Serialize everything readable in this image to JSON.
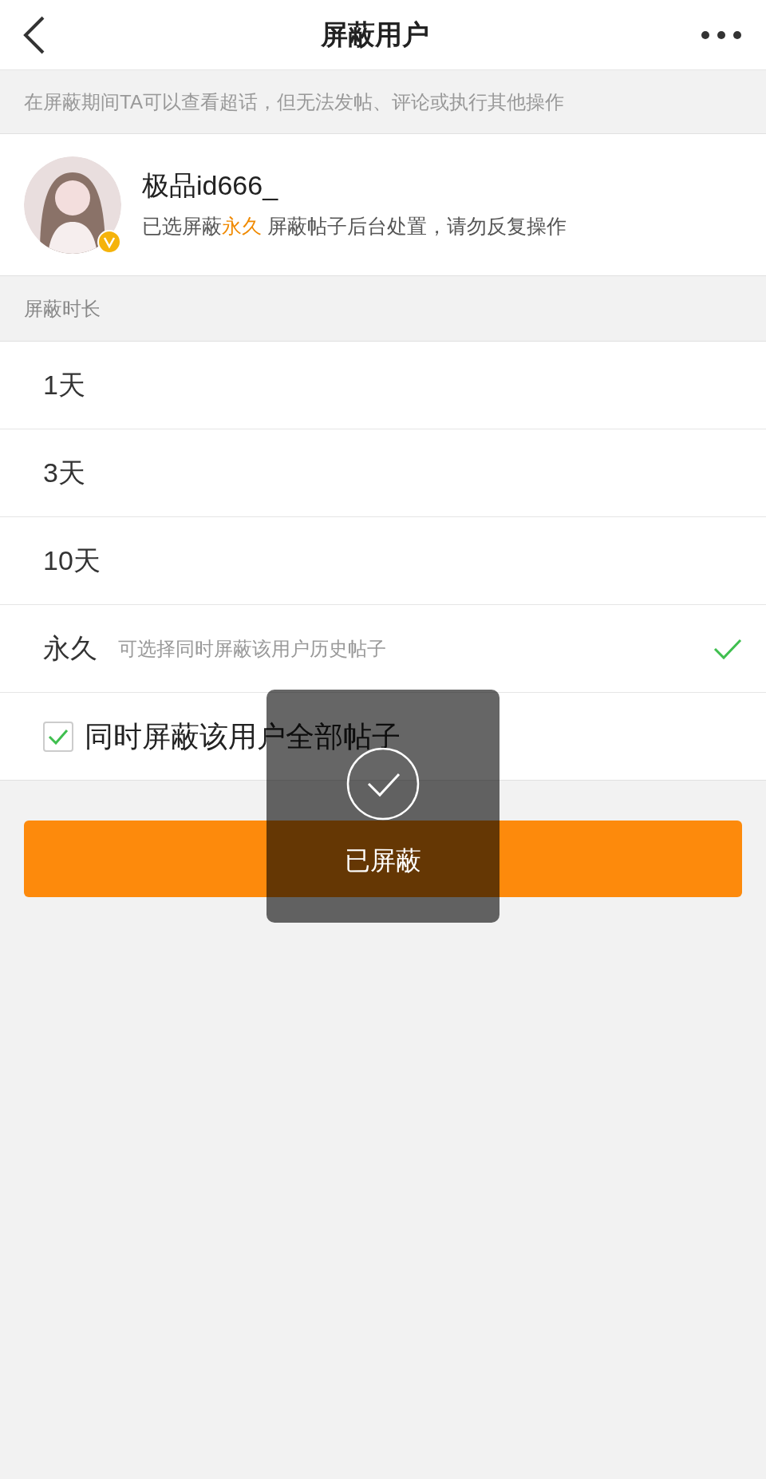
{
  "header": {
    "title": "屏蔽用户"
  },
  "notice": "在屏蔽期间TA可以查看超话，但无法发帖、评论或执行其他操作",
  "user": {
    "name": "极品id666_",
    "verified": true,
    "status": {
      "prefix": "已选屏蔽",
      "highlight": "永久",
      "suffix": " 屏蔽帖子后台处置，请勿反复操作"
    }
  },
  "duration": {
    "label": "屏蔽时长",
    "options": [
      {
        "label": "1天",
        "selected": false
      },
      {
        "label": "3天",
        "selected": false
      },
      {
        "label": "10天",
        "selected": false
      },
      {
        "label": "永久",
        "hint": "可选择同时屏蔽该用户历史帖子",
        "selected": true
      }
    ]
  },
  "block_all_posts": {
    "label": "同时屏蔽该用户全部帖子",
    "checked": true
  },
  "submit_button": {
    "enabled": true
  },
  "toast": {
    "text": "已屏蔽"
  }
}
